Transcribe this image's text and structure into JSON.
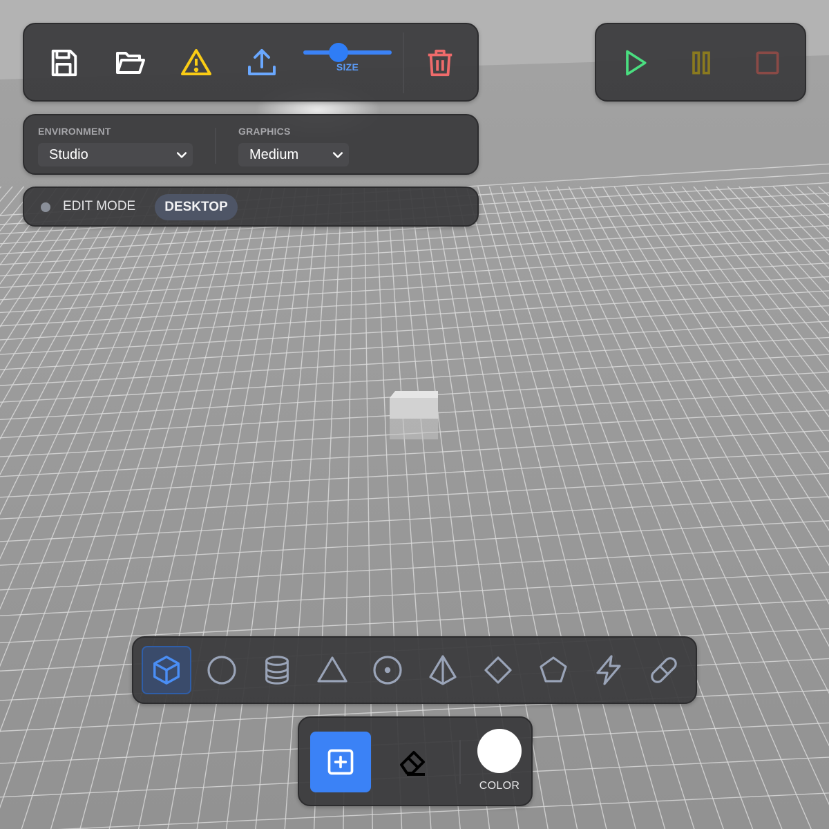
{
  "toolbar": {
    "save_icon": "save-icon",
    "open_icon": "folder-open-icon",
    "warning_icon": "warning-icon",
    "upload_icon": "upload-icon",
    "size_label": "SIZE",
    "size_value": 0.4,
    "delete_icon": "trash-icon"
  },
  "playback": {
    "play_icon": "play-icon",
    "pause_icon": "pause-icon",
    "stop_icon": "stop-icon"
  },
  "settings": {
    "environment_label": "ENVIRONMENT",
    "environment_value": "Studio",
    "graphics_label": "GRAPHICS",
    "graphics_value": "Medium"
  },
  "mode": {
    "edit_label": "EDIT MODE",
    "device_label": "DESKTOP"
  },
  "shapes": {
    "selected": "cube",
    "items": [
      "cube",
      "sphere",
      "cylinder",
      "cone",
      "torus",
      "pyramid",
      "diamond",
      "pentagon",
      "lightning",
      "capsule"
    ]
  },
  "tools": {
    "add_icon": "add-square-icon",
    "eraser_icon": "eraser-icon",
    "color_label": "COLOR",
    "color_value": "#ffffff"
  },
  "colors": {
    "accent": "#3b82f6",
    "panel_bg": "#3a3a3c",
    "warning": "#facc15",
    "danger": "#ef6b6b",
    "play": "#4ade80",
    "pause": "#8a7a1f",
    "stop": "#8a4a46",
    "shape_icon": "#9aa4b8"
  }
}
